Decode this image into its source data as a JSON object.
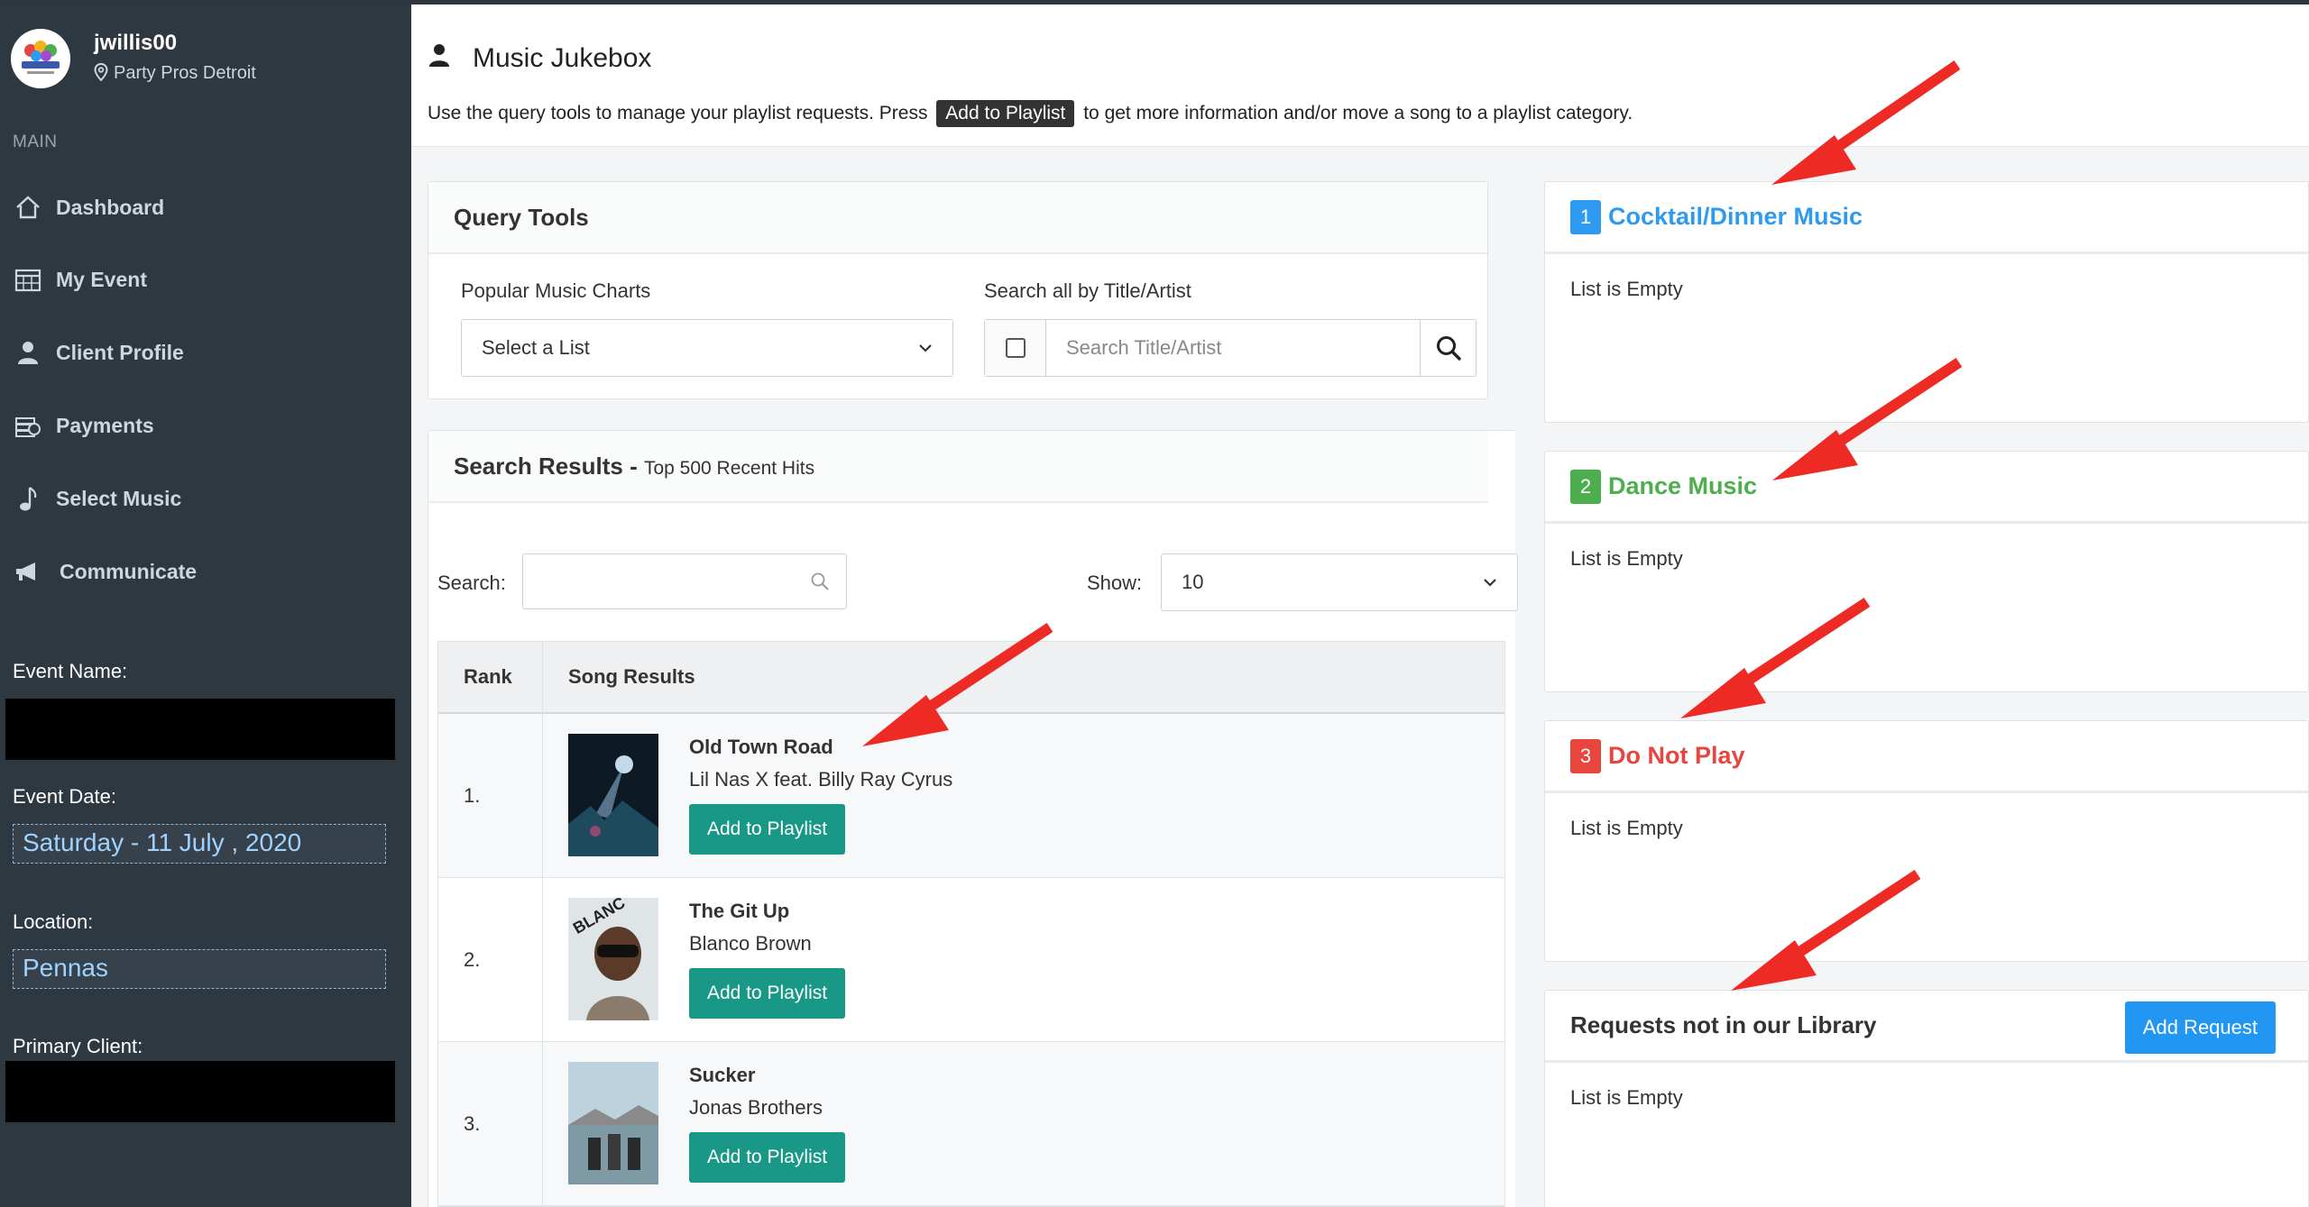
{
  "sidebar": {
    "username": "jwillis00",
    "location": "Party Pros Detroit",
    "section_heading": "MAIN",
    "nav": [
      {
        "label": "Dashboard"
      },
      {
        "label": "My Event"
      },
      {
        "label": "Client Profile"
      },
      {
        "label": "Payments"
      },
      {
        "label": "Select Music"
      },
      {
        "label": "Communicate"
      }
    ],
    "event_name_label": "Event Name:",
    "event_date_label": "Event Date:",
    "event_date_value": "Saturday - 11 July , 2020",
    "location_label": "Location:",
    "location_value": "Pennas",
    "primary_client_label": "Primary Client:"
  },
  "header": {
    "title": "Music Jukebox",
    "intro_before": "Use the query tools to manage your playlist requests. Press",
    "intro_button": "Add to Playlist",
    "intro_after": "to get more information and/or move a song to a playlist category."
  },
  "query_tools": {
    "title": "Query Tools",
    "charts_label": "Popular Music Charts",
    "charts_select": "Select a List",
    "search_label": "Search all by Title/Artist",
    "search_placeholder": "Search Title/Artist"
  },
  "results": {
    "title": "Search Results -",
    "subtitle": "Top 500 Recent Hits",
    "search_label": "Search:",
    "show_label": "Show:",
    "show_value": "10",
    "col_rank": "Rank",
    "col_song": "Song Results",
    "add_label": "Add to Playlist",
    "rows": [
      {
        "rank": "1.",
        "title": "Old Town Road",
        "artist": "Lil Nas X feat. Billy Ray Cyrus"
      },
      {
        "rank": "2.",
        "title": "The Git Up",
        "artist": "Blanco Brown"
      },
      {
        "rank": "3.",
        "title": "Sucker",
        "artist": "Jonas Brothers"
      }
    ]
  },
  "playlists": [
    {
      "number": "1",
      "title": "Cocktail/Dinner Music",
      "color": "#2e9bf0",
      "body": "List is Empty"
    },
    {
      "number": "2",
      "title": "Dance Music",
      "color": "#4cae4c",
      "body": "List is Empty"
    },
    {
      "number": "3",
      "title": "Do Not Play",
      "color": "#e8453c",
      "body": "List is Empty"
    }
  ],
  "requests": {
    "title": "Requests not in our Library",
    "button": "Add Request",
    "body": "List is Empty"
  },
  "colors": {
    "sidebar_bg": "#2e3841",
    "teal_button": "#199888",
    "blue_button": "#2196f3",
    "annotation_arrow": "#ee2a24"
  }
}
